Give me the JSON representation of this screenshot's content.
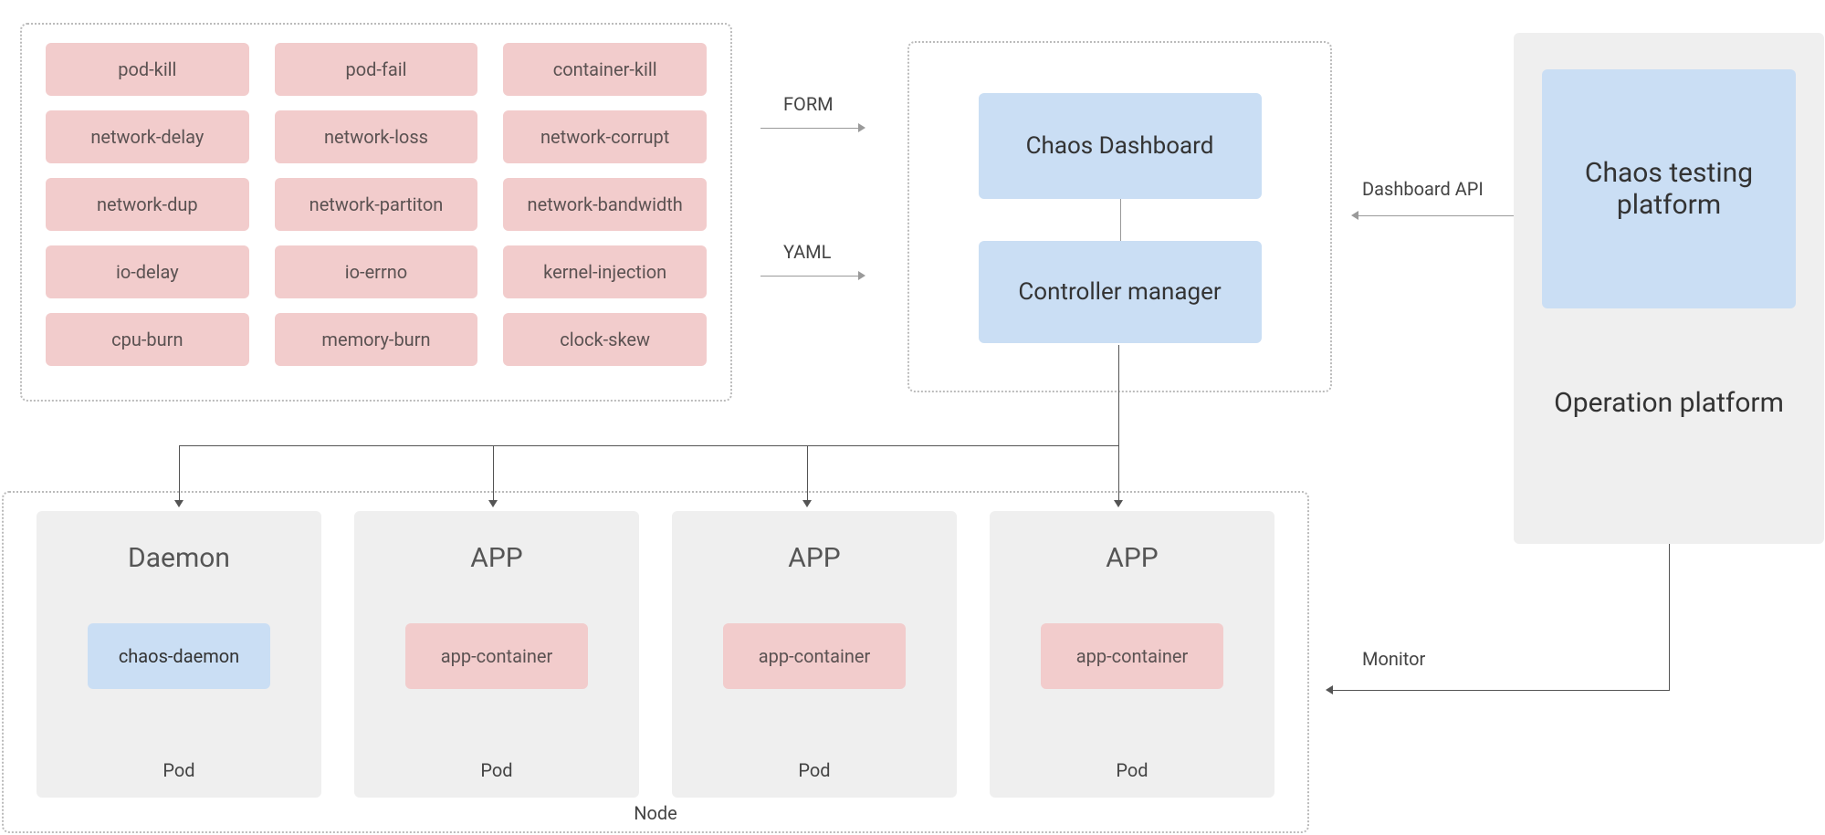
{
  "chaosActions": {
    "row1": [
      "pod-kill",
      "pod-fail",
      "container-kill"
    ],
    "row2": [
      "network-delay",
      "network-loss",
      "network-corrupt"
    ],
    "row3": [
      "network-dup",
      "network-partiton",
      "network-bandwidth"
    ],
    "row4": [
      "io-delay",
      "io-errno",
      "kernel-injection"
    ],
    "row5": [
      "cpu-burn",
      "memory-burn",
      "clock-skew"
    ]
  },
  "labels": {
    "form": "FORM",
    "yaml": "YAML",
    "dashboard": "Chaos Dashboard",
    "controllerManager": "Controller manager",
    "dashboardApi": "Dashboard API",
    "monitor": "Monitor",
    "node": "Node",
    "pod": "Pod"
  },
  "pods": {
    "daemon": {
      "title": "Daemon",
      "container": "chaos-daemon"
    },
    "app": {
      "title": "APP",
      "container": "app-container"
    }
  },
  "platform": {
    "testing": "Chaos testing platform",
    "operation": "Operation platform"
  }
}
